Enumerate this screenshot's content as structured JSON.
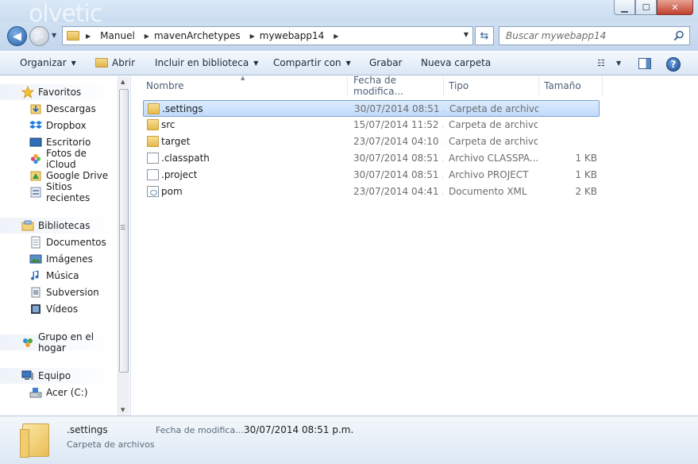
{
  "watermark": "olvetic",
  "window_buttons": {
    "minimize": "▁",
    "maximize": "☐",
    "close": "✕"
  },
  "address": {
    "breadcrumbs": [
      "Manuel",
      "mavenArchetypes",
      "mywebapp14"
    ]
  },
  "search": {
    "placeholder": "Buscar mywebapp14"
  },
  "toolbar": {
    "organize": "Organizar",
    "open": "Abrir",
    "include": "Incluir en biblioteca",
    "share": "Compartir con",
    "burn": "Grabar",
    "new_folder": "Nueva carpeta"
  },
  "nav": {
    "favorites_header": "Favoritos",
    "favorites": [
      "Descargas",
      "Dropbox",
      "Escritorio",
      "Fotos de iCloud",
      "Google Drive",
      "Sitios recientes"
    ],
    "libraries_header": "Bibliotecas",
    "libraries": [
      "Documentos",
      "Imágenes",
      "Música",
      "Subversion",
      "Vídeos"
    ],
    "homegroup": "Grupo en el hogar",
    "computer_header": "Equipo",
    "computer": [
      "Acer (C:)"
    ]
  },
  "columns": {
    "name": "Nombre",
    "date": "Fecha de modifica...",
    "type": "Tipo",
    "size": "Tamaño"
  },
  "files": [
    {
      "name": ".settings",
      "date": "30/07/2014 08:51 ...",
      "type": "Carpeta de archivos",
      "size": "",
      "icon": "folder-icon",
      "selected": true
    },
    {
      "name": "src",
      "date": "15/07/2014 11:52 ...",
      "type": "Carpeta de archivos",
      "size": "",
      "icon": "folder-icon"
    },
    {
      "name": "target",
      "date": "23/07/2014 04:10 ...",
      "type": "Carpeta de archivos",
      "size": "",
      "icon": "folder-icon"
    },
    {
      "name": ".classpath",
      "date": "30/07/2014 08:51 ...",
      "type": "Archivo CLASSPA...",
      "size": "1 KB",
      "icon": "file-icon"
    },
    {
      "name": ".project",
      "date": "30/07/2014 08:51 ...",
      "type": "Archivo PROJECT",
      "size": "1 KB",
      "icon": "file-icon"
    },
    {
      "name": "pom",
      "date": "23/07/2014 04:41 ...",
      "type": "Documento XML",
      "size": "2 KB",
      "icon": "xml-icon"
    }
  ],
  "details": {
    "name": ".settings",
    "type": "Carpeta de archivos",
    "date_label": "Fecha de modifica...",
    "date_value": "30/07/2014 08:51 p.m."
  }
}
